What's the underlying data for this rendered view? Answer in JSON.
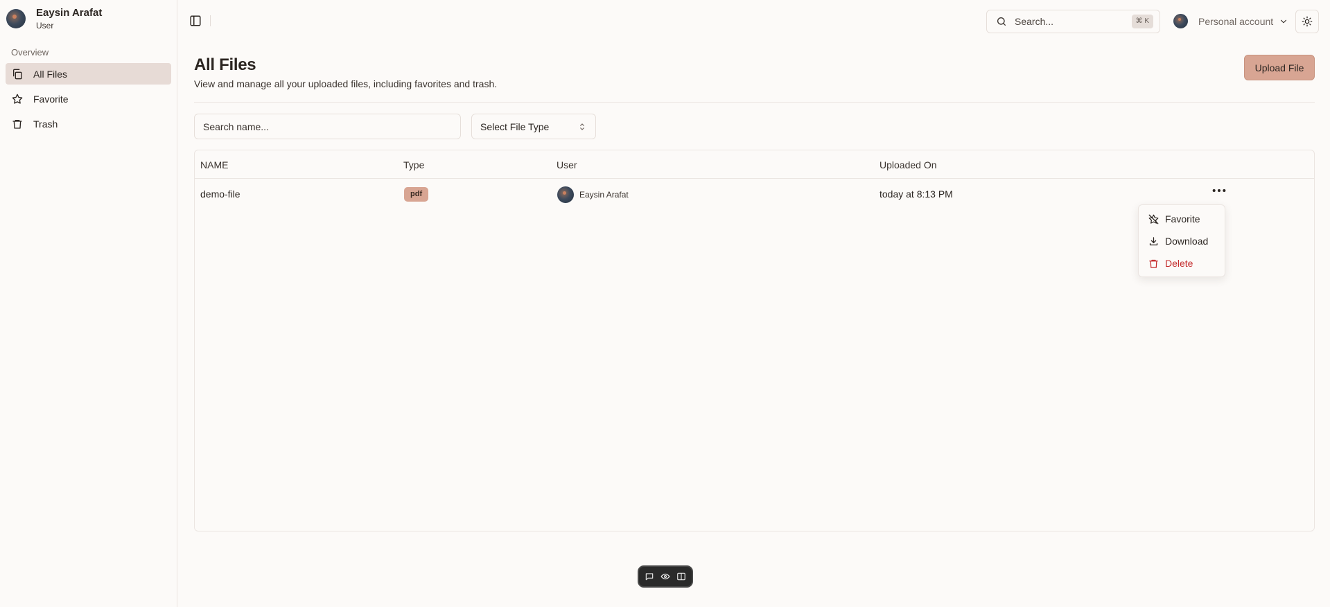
{
  "user": {
    "name": "Eaysin Arafat",
    "role": "User"
  },
  "sidebar": {
    "section": "Overview",
    "items": [
      {
        "label": "All Files",
        "icon": "files-icon",
        "active": true
      },
      {
        "label": "Favorite",
        "icon": "star-icon",
        "active": false
      },
      {
        "label": "Trash",
        "icon": "trash-icon",
        "active": false
      }
    ]
  },
  "topbar": {
    "search_placeholder": "Search...",
    "shortcut": "⌘ K",
    "account_label": "Personal account"
  },
  "header": {
    "title": "All Files",
    "subtitle": "View and manage all your uploaded files, including favorites and trash.",
    "upload_label": "Upload File"
  },
  "filters": {
    "name_placeholder": "Search name...",
    "type_select": "Select File Type"
  },
  "table": {
    "columns": [
      "NAME",
      "Type",
      "User",
      "Uploaded On"
    ],
    "rows": [
      {
        "name": "demo-file",
        "type": "pdf",
        "user": "Eaysin Arafat",
        "uploaded": "today at 8:13 PM"
      }
    ]
  },
  "row_menu": {
    "items": [
      {
        "label": "Favorite",
        "icon": "star-off-icon"
      },
      {
        "label": "Download",
        "icon": "download-icon"
      },
      {
        "label": "Delete",
        "icon": "trash-icon"
      }
    ]
  },
  "colors": {
    "accent": "#d8a593",
    "danger": "#c42b2b",
    "active_nav": "#e7dbd6",
    "background": "#fcfaf8"
  }
}
